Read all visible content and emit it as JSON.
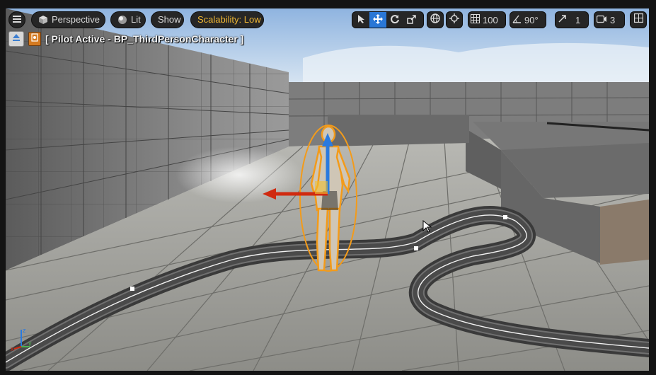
{
  "toolbar": {
    "view_mode": "Perspective",
    "lighting": "Lit",
    "show": "Show",
    "scalability": "Scalability: Low",
    "grid_snap_value": "100",
    "rotation_snap_value": "90°",
    "scale_snap_value": "1",
    "camera_speed_value": "3"
  },
  "pilot": {
    "label": "[ Pilot Active - BP_ThirdPersonCharacter ]"
  },
  "colors": {
    "accent_active": "#2a77d6",
    "scalability": "#f0b733",
    "selection_outline": "#f39b1a",
    "gizmo_x": "#d02a10",
    "gizmo_z": "#2a7adf"
  },
  "icons": [
    "menu-icon",
    "perspective-cube-icon",
    "lit-sphere-icon",
    "select-icon",
    "translate-icon",
    "rotate-icon",
    "scale-icon",
    "world-space-icon",
    "surface-snap-icon",
    "grid-snap-icon",
    "angle-snap-icon",
    "scale-snap-icon",
    "camera-speed-icon",
    "viewport-options-icon",
    "eject-icon",
    "blueprint-icon",
    "axis-indicator-icon",
    "mouse-cursor-icon"
  ]
}
